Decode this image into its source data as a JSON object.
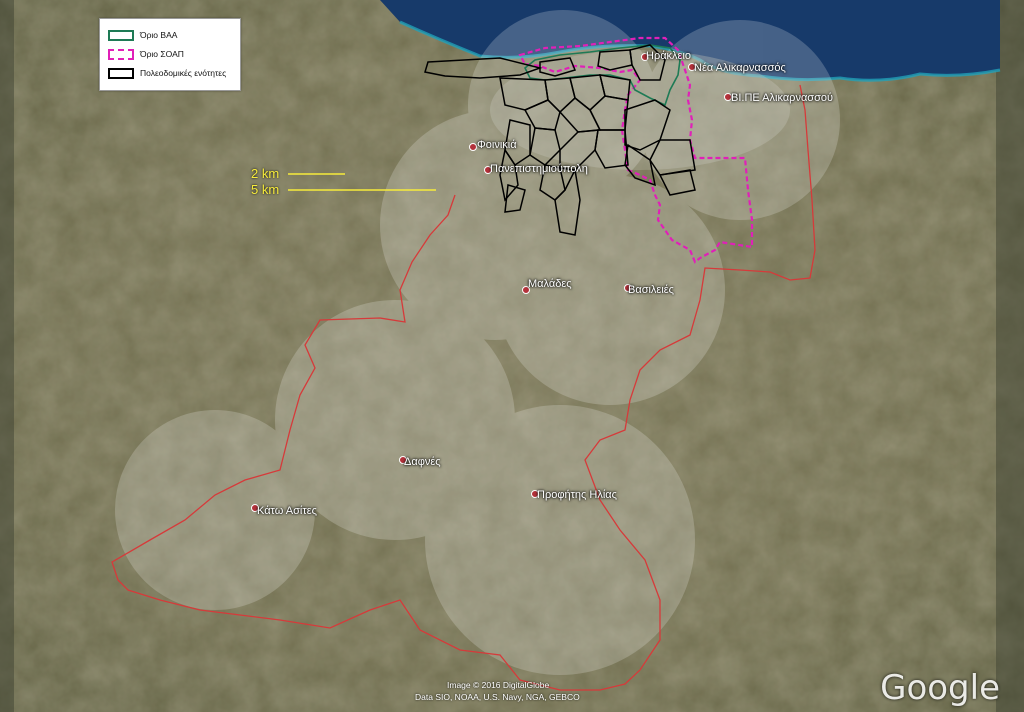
{
  "legend": {
    "items": [
      {
        "label": "Όριο ΒΑΑ",
        "color": "#1e7a55",
        "style": "solid"
      },
      {
        "label": "Όριο ΣΟΑΠ",
        "color": "#e020b8",
        "style": "dashed"
      },
      {
        "label": "Πολεοδομικές ενότητες",
        "color": "#000000",
        "style": "solid"
      }
    ]
  },
  "scale": {
    "label_2km": "2 km",
    "label_5km": "5 km",
    "color": "#f7ec3b"
  },
  "places": [
    {
      "name": "Ηράκλειο",
      "id": "irakleio"
    },
    {
      "name": "Νέα Αλικαρνασσός",
      "id": "nea-alikarnassos"
    },
    {
      "name": "ΒΙ.ΠΕ Αλικαρνασσού",
      "id": "vipe-alikarnassou"
    },
    {
      "name": "Φοινικιά",
      "id": "foinikia"
    },
    {
      "name": "Πανεπιστημιούπολη",
      "id": "panepistimioupoli"
    },
    {
      "name": "Μαλάδες",
      "id": "malades"
    },
    {
      "name": "Βασιλειές",
      "id": "vasileies"
    },
    {
      "name": "Δαφνές",
      "id": "dafnes"
    },
    {
      "name": "Κάτω Ασίτες",
      "id": "kato-asites"
    },
    {
      "name": "Προφήτης Ηλίας",
      "id": "profitis-ilias"
    }
  ],
  "attribution": {
    "line1": "Image © 2016 DigitalGlobe",
    "line2": "Data SIO, NOAA, U.S. Navy, NGA, GEBCO",
    "logo": "Google"
  },
  "colors": {
    "boundary": "#d63a3a",
    "sea": "#173a6a",
    "coast": "#20a0b8"
  }
}
